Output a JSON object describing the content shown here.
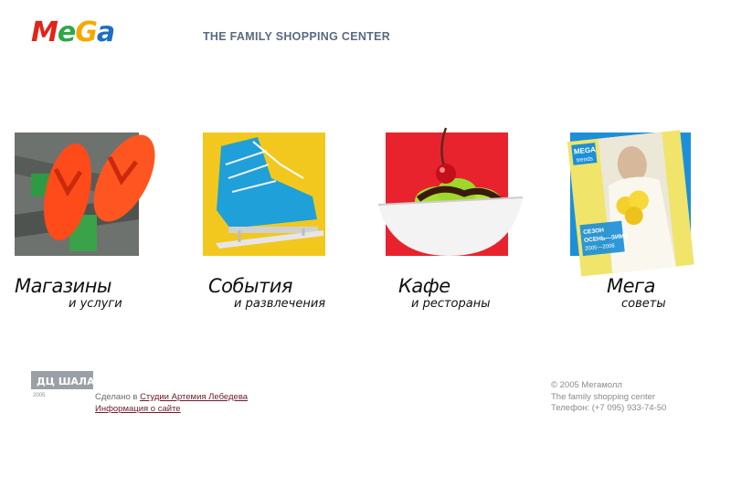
{
  "header": {
    "logo_text": "MeGa",
    "tagline": "THE FAMILY SHOPPING CENTER"
  },
  "tiles": [
    {
      "title": "Магазины",
      "subtitle": "и услуги"
    },
    {
      "title": "События",
      "subtitle": "и развлечения"
    },
    {
      "title": "Кафе",
      "subtitle": "и рестораны"
    },
    {
      "title": "Мега",
      "subtitle": "советы"
    }
  ],
  "magazine_cover": {
    "brand": "MEGA",
    "name": "trends",
    "season_line1": "СЕЗОН",
    "season_line2": "ОСЕНЬ—ЗИМА",
    "years": "2005—2006"
  },
  "footer": {
    "studio_logo_text": "ДЦ ШАЛАШУ",
    "studio_logo_year": "2005",
    "made_prefix": "Сделано в ",
    "made_link": "Студии Артемия Лебедева",
    "info_link": "Информация о сайте",
    "copyright": "© 2005 Мегамолл",
    "company": "The family shopping center",
    "phone": "Телефон: (+7 095) 933-74-50"
  },
  "colors": {
    "tagline": "#5b6a80",
    "link": "#6b1a2a",
    "logo_red": "#e2231a",
    "logo_green": "#2ea84a",
    "logo_yellow": "#f7c500",
    "logo_blue": "#1d6fc2"
  }
}
